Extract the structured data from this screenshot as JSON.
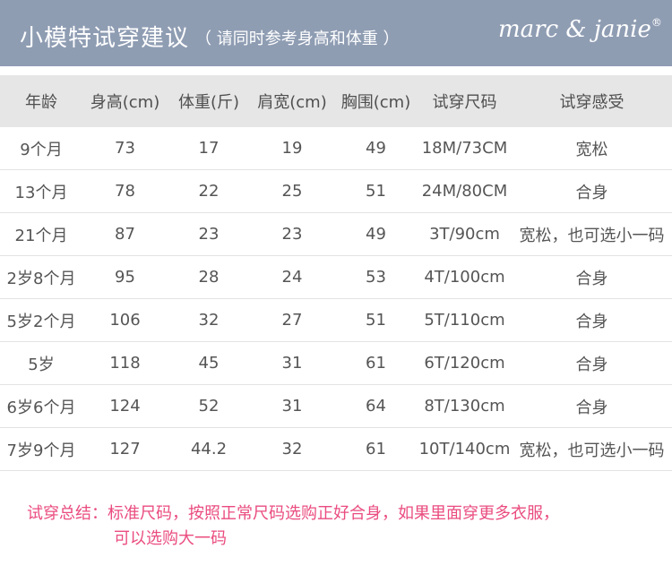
{
  "header": {
    "title": "小模特试穿建议",
    "subtitle": "（ 请同时参考身高和体重 ）",
    "brand": "marc & janie",
    "brand_mark": "®"
  },
  "table": {
    "columns": [
      "年龄",
      "身高(cm)",
      "体重(斤)",
      "肩宽(cm)",
      "胸围(cm)",
      "试穿尺码",
      "试穿感受"
    ],
    "rows": [
      [
        "9个月",
        "73",
        "17",
        "19",
        "49",
        "18M/73CM",
        "宽松"
      ],
      [
        "13个月",
        "78",
        "22",
        "25",
        "51",
        "24M/80CM",
        "合身"
      ],
      [
        "21个月",
        "87",
        "23",
        "23",
        "49",
        "3T/90cm",
        "宽松，也可选小一码"
      ],
      [
        "2岁8个月",
        "95",
        "28",
        "24",
        "53",
        "4T/100cm",
        "合身"
      ],
      [
        "5岁2个月",
        "106",
        "32",
        "27",
        "51",
        "5T/110cm",
        "合身"
      ],
      [
        "5岁",
        "118",
        "45",
        "31",
        "61",
        "6T/120cm",
        "合身"
      ],
      [
        "6岁6个月",
        "124",
        "52",
        "31",
        "64",
        "8T/130cm",
        "合身"
      ],
      [
        "7岁9个月",
        "127",
        "44.2",
        "32",
        "61",
        "10T/140cm",
        "宽松，也可选小一码"
      ]
    ]
  },
  "summary": {
    "line1": "试穿总结：标准尺码，按照正常尺码选购正好合身，如果里面穿更多衣服，",
    "line2": "可以选购大一码"
  },
  "colors": {
    "header_bg": "#8f9db3",
    "table_header_bg": "#e6e6e6",
    "summary_text": "#ea4c7f"
  }
}
